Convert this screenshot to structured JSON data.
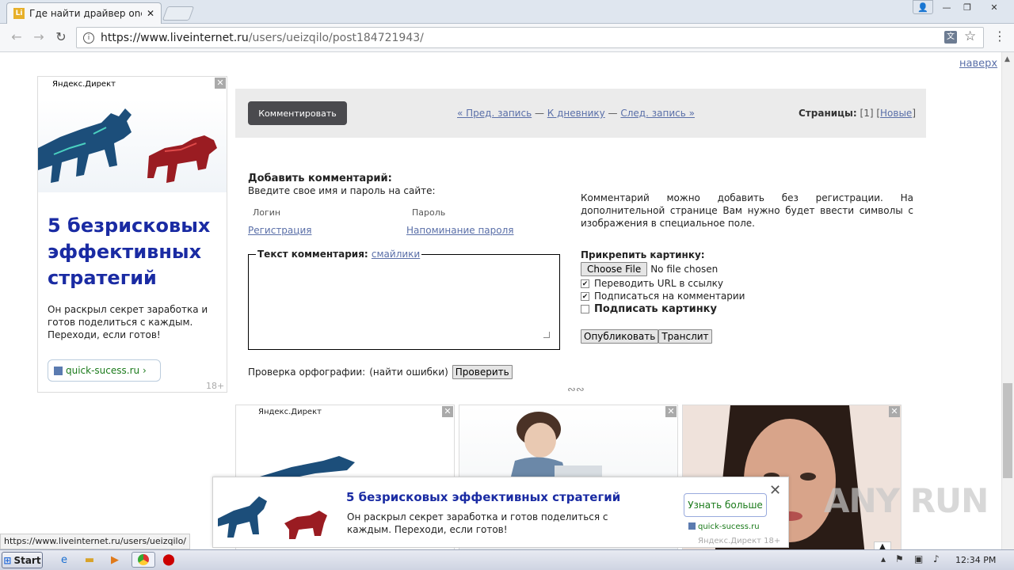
{
  "browser": {
    "tab_title": "Где найти драйвер onext",
    "tab_close": "✕",
    "url_host": "https://www.liveinternet.ru",
    "url_path": "/users/ueizqilo/post184721943/"
  },
  "page": {
    "top_link": "наверх",
    "ad_left": {
      "brand": "Яндекс.Директ",
      "headline": "5 безрисковых эффективных стратегий",
      "body": "Он раскрыл секрет заработка и готов поделиться с каждым. Переходи, если готов!",
      "domain": "quick-sucess.ru ›",
      "age": "18+"
    },
    "navbar": {
      "comment_button": "Комментировать",
      "prev": "« Пред. запись",
      "sep1": " — ",
      "diary": "К дневнику",
      "sep2": " — ",
      "next": "След. запись »",
      "pages_label": "Страницы:",
      "pages_current": " [1] [",
      "pages_new": "Новые",
      "pages_close": "]"
    },
    "form": {
      "title": "Добавить комментарий:",
      "subtitle": "Введите свое имя и пароль на сайте:",
      "login_label": "Логин",
      "password_label": "Пароль",
      "register_link": "Регистрация",
      "remind_link": "Напоминание пароля",
      "legend_label": "Текст комментария: ",
      "smileys_link": "смайлики",
      "spell_label": "Проверка орфографии:",
      "spell_find": "(найти ошибки)",
      "spell_button": "Проверить",
      "info_text": "Комментарий можно добавить без регистрации. На дополнительной странице Вам нужно будет ввести символы с изображения в специальное поле.",
      "attach_title": "Прикрепить картинку:",
      "choose_file": "Choose File",
      "no_file": "No file chosen",
      "options": [
        {
          "label": "Переводить URL в ссылку",
          "checked": true
        },
        {
          "label": "Подписаться на комментарии",
          "checked": true
        },
        {
          "label": "Подписать картинку",
          "checked": false
        }
      ],
      "publish_button": "Опубликовать",
      "translit_button": "Транслит",
      "divider": "∾∾"
    },
    "ad_bottom": {
      "brand": "Яндекс.Директ"
    },
    "popup": {
      "headline": "5 безрисковых эффективных стратегий",
      "body": "Он раскрыл секрет заработка и готов поделиться с каждым. Переходи, если готов!",
      "cta": "Узнать больше",
      "domain": "quick-sucess.ru",
      "brand": "Яндекс.Директ  18+"
    },
    "status_url": "https://www.liveinternet.ru/users/ueizqilo/",
    "watermark": "ANY RUN"
  },
  "taskbar": {
    "start": "Start",
    "clock": "12:34 PM"
  },
  "colors": {
    "link": "#5a6fa8",
    "ad_headline": "#1a2ba3",
    "domain_green": "#1a7a1a"
  }
}
